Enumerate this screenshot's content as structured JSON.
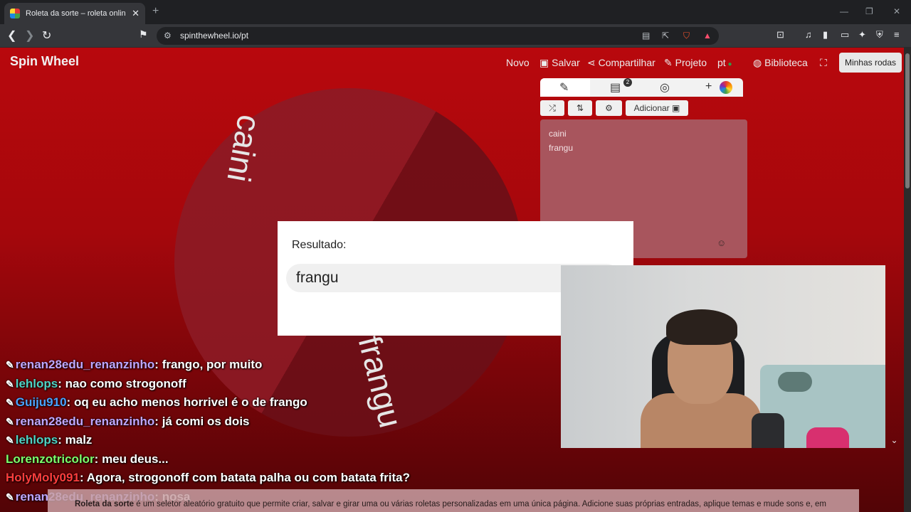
{
  "browser": {
    "tab_title": "Roleta da sorte – roleta online gr",
    "tab_close": "✕",
    "new_tab": "+",
    "url": "spinthewheel.io/pt",
    "min": "—",
    "max": "❐",
    "close": "✕"
  },
  "site": {
    "logo": "Spin Wheel",
    "nav": {
      "novo": "Novo",
      "salvar": "Salvar",
      "compartilhar": "Compartilhar",
      "projeto": "Projeto",
      "lang": "pt",
      "biblioteca": "Biblioteca",
      "minhas_rodas": "Minhas rodas"
    }
  },
  "wheel": {
    "segments": [
      "caini",
      "frangu"
    ]
  },
  "editor": {
    "badge_count": "2",
    "adicionar_label": "Adicionar",
    "entries": [
      "caini",
      "frangu"
    ]
  },
  "result": {
    "label": "Resultado:",
    "value": "frangu"
  },
  "chat": [
    {
      "user": "renan28edu_renanzinho",
      "color": "#bfa7ff",
      "badge": true,
      "msg": "frango, por muito"
    },
    {
      "user": "lehlops",
      "color": "#4fd2c3",
      "badge": true,
      "msg": "nao como strogonoff"
    },
    {
      "user": "Guiju910",
      "color": "#4aa3ff",
      "badge": true,
      "msg": "oq eu acho menos horrivel é o de frango"
    },
    {
      "user": "renan28edu_renanzinho",
      "color": "#bfa7ff",
      "badge": true,
      "msg": "já comi os dois"
    },
    {
      "user": "lehlops",
      "color": "#4fd2c3",
      "badge": true,
      "msg": "malz"
    },
    {
      "user": "Lorenzotricolor",
      "color": "#7cff6b",
      "badge": false,
      "msg": "meu deus..."
    },
    {
      "user": "HolyMoly091",
      "color": "#ff3d3d",
      "badge": false,
      "msg": "Agora, strogonoff com batata palha ou com batata frita?"
    },
    {
      "user": "renan28edu_renanzinho",
      "color": "#bfa7ff",
      "badge": true,
      "msg": "nosa"
    }
  ],
  "footer": {
    "bold": "Roleta da sorte",
    "text": " é um seletor aleatório gratuito que permite criar, salvar e girar uma ou várias roletas personalizadas em uma única página. Adicione suas próprias entradas, aplique temas e mude sons e, em"
  }
}
